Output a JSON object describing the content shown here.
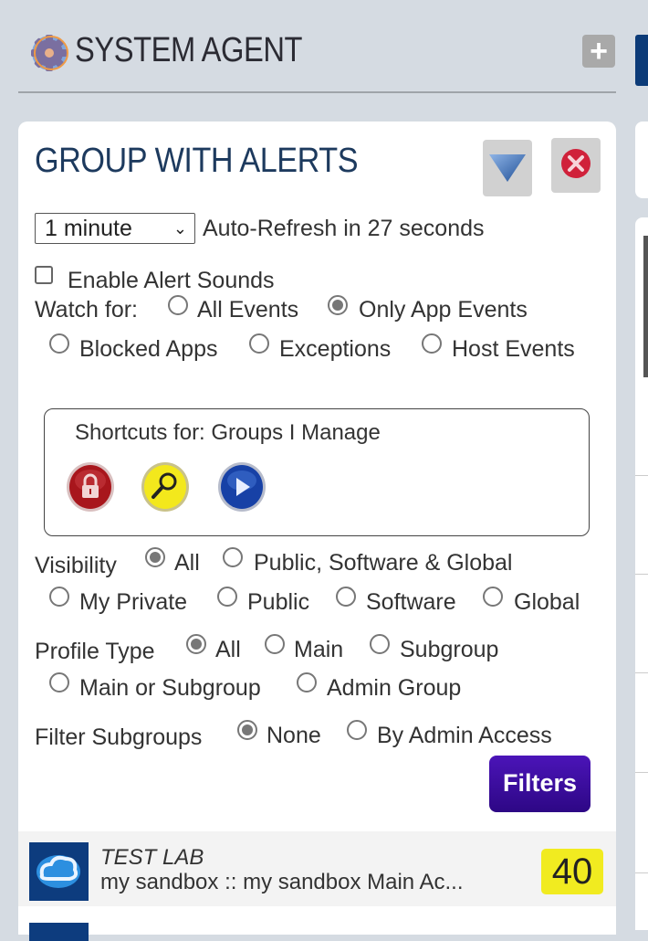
{
  "header": {
    "title": "SYSTEM AGENT",
    "add_label": "+"
  },
  "panel": {
    "title": "GROUP WITH ALERTS",
    "refresh": {
      "interval_selected": "1 minute",
      "status_text": "Auto-Refresh in 27 seconds"
    },
    "alert_sounds": {
      "label": "Enable Alert Sounds",
      "checked": false
    },
    "watch_for": {
      "label": "Watch for:",
      "options": [
        {
          "label": "All Events",
          "checked": false
        },
        {
          "label": "Only App Events",
          "checked": true
        },
        {
          "label": "Blocked Apps",
          "checked": false
        },
        {
          "label": "Exceptions",
          "checked": false
        },
        {
          "label": "Host Events",
          "checked": false
        }
      ]
    },
    "shortcuts": {
      "title": "Shortcuts for: Groups I Manage",
      "icons": [
        "lock-icon",
        "search-icon",
        "play-icon"
      ]
    },
    "visibility": {
      "label": "Visibility",
      "options": [
        {
          "label": "All",
          "checked": true
        },
        {
          "label": "Public, Software & Global",
          "checked": false
        },
        {
          "label": "My Private",
          "checked": false
        },
        {
          "label": "Public",
          "checked": false
        },
        {
          "label": "Software",
          "checked": false
        },
        {
          "label": "Global",
          "checked": false
        }
      ]
    },
    "profile_type": {
      "label": "Profile Type",
      "options": [
        {
          "label": "All",
          "checked": true
        },
        {
          "label": "Main",
          "checked": false
        },
        {
          "label": "Subgroup",
          "checked": false
        },
        {
          "label": "Main or Subgroup",
          "checked": false
        },
        {
          "label": "Admin Group",
          "checked": false
        }
      ]
    },
    "filter_subgroups": {
      "label": "Filter Subgroups",
      "options": [
        {
          "label": "None",
          "checked": true
        },
        {
          "label": "By Admin Access",
          "checked": false
        }
      ]
    },
    "filters_button": "Filters",
    "list": [
      {
        "name": "TEST LAB",
        "subtitle": "my sandbox :: my sandbox Main Ac...",
        "count": "40"
      }
    ]
  },
  "colors": {
    "background": "#d5dbe2",
    "title_blue": "#1d3a5e",
    "filters_purple": "#3a0aa0",
    "badge_yellow": "#f1eb20"
  }
}
